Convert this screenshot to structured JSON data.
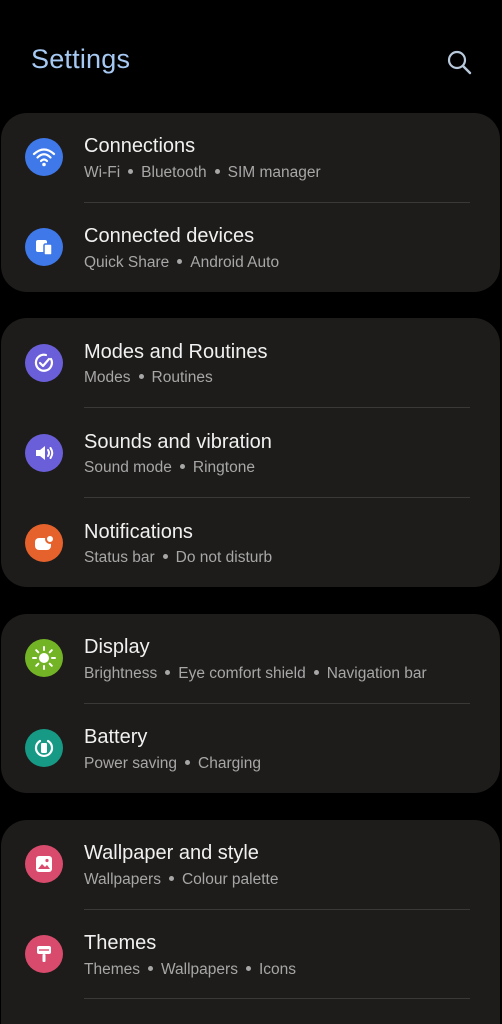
{
  "header": {
    "title": "Settings",
    "title_color": "#a6c9f3",
    "search_icon": "search-icon"
  },
  "groups": [
    {
      "items": [
        {
          "title": "Connections",
          "subtitle": [
            "Wi-Fi",
            "Bluetooth",
            "SIM manager"
          ],
          "icon": "wifi-icon",
          "icon_color": "#3f78e8"
        },
        {
          "title": "Connected devices",
          "subtitle": [
            "Quick Share",
            "Android Auto"
          ],
          "icon": "connected-devices-icon",
          "icon_color": "#3f78e8"
        }
      ]
    },
    {
      "items": [
        {
          "title": "Modes and Routines",
          "subtitle": [
            "Modes",
            "Routines"
          ],
          "icon": "modes-routines-icon",
          "icon_color": "#6a5fd8"
        },
        {
          "title": "Sounds and vibration",
          "subtitle": [
            "Sound mode",
            "Ringtone"
          ],
          "icon": "speaker-icon",
          "icon_color": "#6a5fd8"
        },
        {
          "title": "Notifications",
          "subtitle": [
            "Status bar",
            "Do not disturb"
          ],
          "icon": "notification-icon",
          "icon_color": "#e5622c"
        }
      ]
    },
    {
      "items": [
        {
          "title": "Display",
          "subtitle": [
            "Brightness",
            "Eye comfort shield",
            "Navigation bar"
          ],
          "icon": "sun-icon",
          "icon_color": "#72b425"
        },
        {
          "title": "Battery",
          "subtitle": [
            "Power saving",
            "Charging"
          ],
          "icon": "battery-icon",
          "icon_color": "#169a86"
        }
      ]
    },
    {
      "items": [
        {
          "title": "Wallpaper and style",
          "subtitle": [
            "Wallpapers",
            "Colour palette"
          ],
          "icon": "wallpaper-icon",
          "icon_color": "#d94b6d"
        },
        {
          "title": "Themes",
          "subtitle": [
            "Themes",
            "Wallpapers",
            "Icons"
          ],
          "icon": "themes-icon",
          "icon_color": "#d94b6d"
        }
      ]
    }
  ]
}
